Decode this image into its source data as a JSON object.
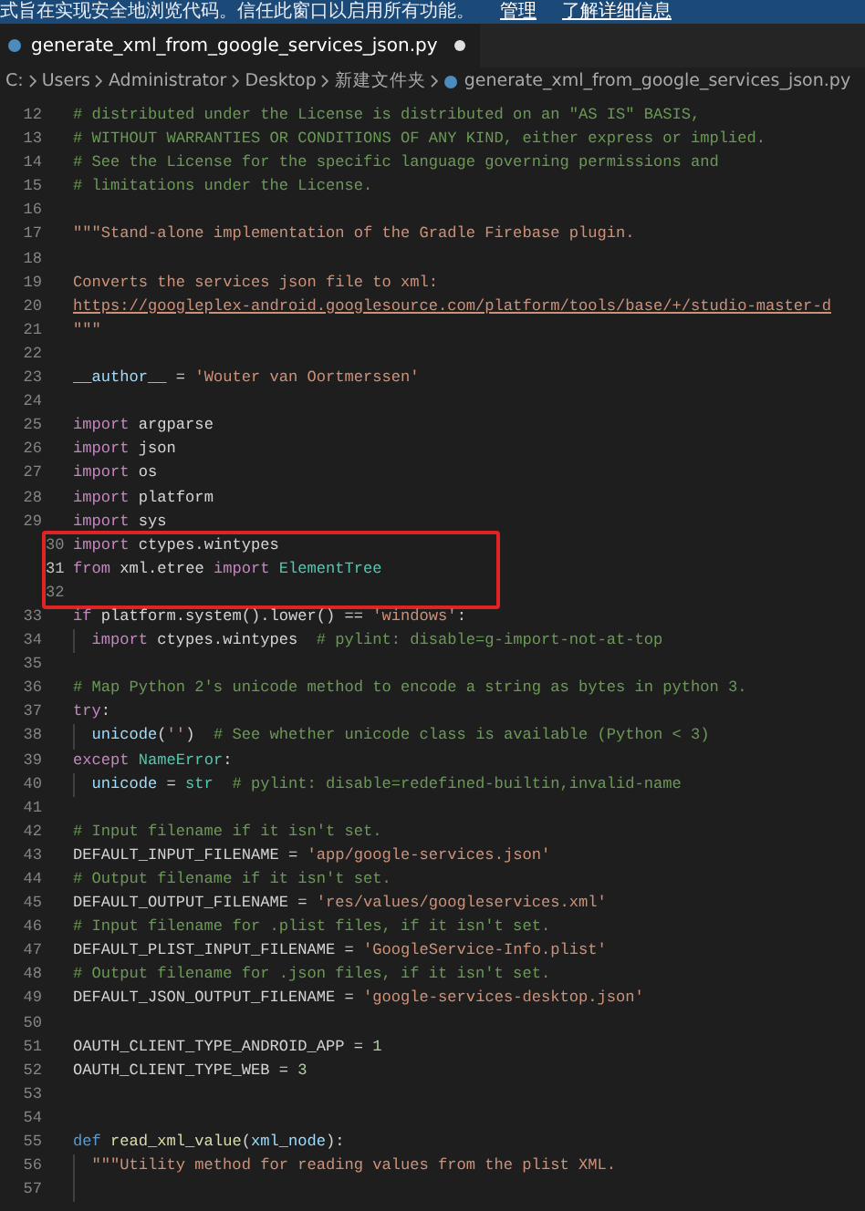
{
  "banner": {
    "text": "式旨在实现安全地浏览代码。信任此窗口以启用所有功能。",
    "links": [
      "管理",
      "了解详细信息"
    ]
  },
  "tab": {
    "title": "generate_xml_from_google_services_json.py",
    "modified": true
  },
  "breadcrumb": [
    "C:",
    "Users",
    "Administrator",
    "Desktop",
    "新建文件夹",
    "generate_xml_from_google_services_json.py"
  ],
  "lines": [
    {
      "number": "12",
      "current": false,
      "boxed": false,
      "guide": false,
      "tokens": [
        {
          "kind": "comment",
          "text": "# distributed under the License is distributed on an \"AS IS\" BASIS,"
        }
      ]
    },
    {
      "number": "13",
      "current": false,
      "boxed": false,
      "guide": false,
      "tokens": [
        {
          "kind": "comment",
          "text": "# WITHOUT WARRANTIES OR CONDITIONS OF ANY KIND, either express or implied."
        }
      ]
    },
    {
      "number": "14",
      "current": false,
      "boxed": false,
      "guide": false,
      "tokens": [
        {
          "kind": "comment",
          "text": "# See the License for the specific language governing permissions and"
        }
      ]
    },
    {
      "number": "15",
      "current": false,
      "boxed": false,
      "guide": false,
      "tokens": [
        {
          "kind": "comment",
          "text": "# limitations under the License."
        }
      ]
    },
    {
      "number": "16",
      "current": false,
      "boxed": false,
      "guide": false
    },
    {
      "number": "17",
      "current": false,
      "boxed": false,
      "guide": false,
      "tokens": [
        {
          "kind": "string",
          "text": "\"\"\"Stand-alone implementation of the Gradle Firebase plugin."
        }
      ]
    },
    {
      "number": "18",
      "current": false,
      "boxed": false,
      "guide": false
    },
    {
      "number": "19",
      "current": false,
      "boxed": false,
      "guide": false,
      "tokens": [
        {
          "kind": "string",
          "text": "Converts the services json file to xml:"
        }
      ]
    },
    {
      "number": "20",
      "current": false,
      "boxed": false,
      "guide": false,
      "tokens": [
        {
          "kind": "link",
          "text": "https://googleplex-android.googlesource.com/platform/tools/base/+/studio-master-d"
        }
      ]
    },
    {
      "number": "21",
      "current": false,
      "boxed": false,
      "guide": false,
      "tokens": [
        {
          "kind": "string",
          "text": "\"\"\""
        }
      ]
    },
    {
      "number": "22",
      "current": false,
      "boxed": false,
      "guide": false
    },
    {
      "number": "23",
      "current": false,
      "boxed": false,
      "guide": false,
      "tokens": [
        {
          "kind": "variable",
          "text": "__author__"
        },
        {
          "kind": "plain",
          "text": " = "
        },
        {
          "kind": "string",
          "text": "'Wouter van Oortmerssen'"
        }
      ]
    },
    {
      "number": "24",
      "current": false,
      "boxed": false,
      "guide": false
    },
    {
      "number": "25",
      "current": false,
      "boxed": false,
      "guide": false,
      "tokens": [
        {
          "kind": "keyword",
          "text": "import"
        },
        {
          "kind": "plain",
          "text": " argparse"
        }
      ]
    },
    {
      "number": "26",
      "current": false,
      "boxed": false,
      "guide": false,
      "tokens": [
        {
          "kind": "keyword",
          "text": "import"
        },
        {
          "kind": "plain",
          "text": " json"
        }
      ]
    },
    {
      "number": "27",
      "current": false,
      "boxed": false,
      "guide": false,
      "tokens": [
        {
          "kind": "keyword",
          "text": "import"
        },
        {
          "kind": "plain",
          "text": " os"
        }
      ]
    },
    {
      "number": "28",
      "current": false,
      "boxed": false,
      "guide": false,
      "tokens": [
        {
          "kind": "keyword",
          "text": "import"
        },
        {
          "kind": "plain",
          "text": " platform"
        }
      ]
    },
    {
      "number": "29",
      "current": false,
      "boxed": false,
      "guide": false,
      "tokens": [
        {
          "kind": "keyword",
          "text": "import"
        },
        {
          "kind": "plain",
          "text": " sys"
        }
      ]
    },
    {
      "number": "30",
      "current": false,
      "boxed": true,
      "guide": false,
      "tokens": [
        {
          "kind": "keyword",
          "text": "import"
        },
        {
          "kind": "plain",
          "text": " ctypes.wintypes"
        }
      ]
    },
    {
      "number": "31",
      "current": true,
      "boxed": true,
      "guide": false,
      "tokens": [
        {
          "kind": "keyword",
          "text": "from"
        },
        {
          "kind": "plain",
          "text": " xml.etree "
        },
        {
          "kind": "keyword",
          "text": "import"
        },
        {
          "kind": "class",
          "text": " ElementTree"
        }
      ]
    },
    {
      "number": "32",
      "current": false,
      "boxed": true,
      "guide": false
    },
    {
      "number": "33",
      "current": false,
      "boxed": false,
      "guide": false,
      "tokens": [
        {
          "kind": "keyword",
          "text": "if"
        },
        {
          "kind": "plain",
          "text": " platform.system().lower() == "
        },
        {
          "kind": "string",
          "text": "'windows'"
        },
        {
          "kind": "plain",
          "text": ":"
        }
      ]
    },
    {
      "number": "34",
      "current": false,
      "boxed": false,
      "guide": true,
      "tokens": [
        {
          "kind": "keyword",
          "text": "import"
        },
        {
          "kind": "plain",
          "text": " ctypes.wintypes  "
        },
        {
          "kind": "comment",
          "text": "# pylint: disable=g-import-not-at-top"
        }
      ]
    },
    {
      "number": "35",
      "current": false,
      "boxed": false,
      "guide": false
    },
    {
      "number": "36",
      "current": false,
      "boxed": false,
      "guide": false,
      "tokens": [
        {
          "kind": "comment",
          "text": "# Map Python 2's unicode method to encode a string as bytes in python 3."
        }
      ]
    },
    {
      "number": "37",
      "current": false,
      "boxed": false,
      "guide": false,
      "tokens": [
        {
          "kind": "keyword",
          "text": "try"
        },
        {
          "kind": "plain",
          "text": ":"
        }
      ]
    },
    {
      "number": "38",
      "current": false,
      "boxed": false,
      "guide": true,
      "tokens": [
        {
          "kind": "variable",
          "text": "unicode"
        },
        {
          "kind": "plain",
          "text": "("
        },
        {
          "kind": "string",
          "text": "''"
        },
        {
          "kind": "plain",
          "text": ")  "
        },
        {
          "kind": "comment",
          "text": "# See whether unicode class is available (Python < 3)"
        }
      ]
    },
    {
      "number": "39",
      "current": false,
      "boxed": false,
      "guide": false,
      "tokens": [
        {
          "kind": "keyword",
          "text": "except"
        },
        {
          "kind": "class",
          "text": " NameError"
        },
        {
          "kind": "plain",
          "text": ":"
        }
      ]
    },
    {
      "number": "40",
      "current": false,
      "boxed": false,
      "guide": true,
      "tokens": [
        {
          "kind": "variable",
          "text": "unicode"
        },
        {
          "kind": "plain",
          "text": " = "
        },
        {
          "kind": "class",
          "text": "str"
        },
        {
          "kind": "comment",
          "text": "  # pylint: disable=redefined-builtin,invalid-name"
        }
      ]
    },
    {
      "number": "41",
      "current": false,
      "boxed": false,
      "guide": false
    },
    {
      "number": "42",
      "current": false,
      "boxed": false,
      "guide": false,
      "tokens": [
        {
          "kind": "comment",
          "text": "# Input filename if it isn't set."
        }
      ]
    },
    {
      "number": "43",
      "current": false,
      "boxed": false,
      "guide": false,
      "tokens": [
        {
          "kind": "constant",
          "text": "DEFAULT_INPUT_FILENAME"
        },
        {
          "kind": "plain",
          "text": " = "
        },
        {
          "kind": "string",
          "text": "'app/google-services.json'"
        }
      ]
    },
    {
      "number": "44",
      "current": false,
      "boxed": false,
      "guide": false,
      "tokens": [
        {
          "kind": "comment",
          "text": "# Output filename if it isn't set."
        }
      ]
    },
    {
      "number": "45",
      "current": false,
      "boxed": false,
      "guide": false,
      "tokens": [
        {
          "kind": "constant",
          "text": "DEFAULT_OUTPUT_FILENAME"
        },
        {
          "kind": "plain",
          "text": " = "
        },
        {
          "kind": "string",
          "text": "'res/values/googleservices.xml'"
        }
      ]
    },
    {
      "number": "46",
      "current": false,
      "boxed": false,
      "guide": false,
      "tokens": [
        {
          "kind": "comment",
          "text": "# Input filename for .plist files, if it isn't set."
        }
      ]
    },
    {
      "number": "47",
      "current": false,
      "boxed": false,
      "guide": false,
      "tokens": [
        {
          "kind": "constant",
          "text": "DEFAULT_PLIST_INPUT_FILENAME"
        },
        {
          "kind": "plain",
          "text": " = "
        },
        {
          "kind": "string",
          "text": "'GoogleService-Info.plist'"
        }
      ]
    },
    {
      "number": "48",
      "current": false,
      "boxed": false,
      "guide": false,
      "tokens": [
        {
          "kind": "comment",
          "text": "# Output filename for .json files, if it isn't set."
        }
      ]
    },
    {
      "number": "49",
      "current": false,
      "boxed": false,
      "guide": false,
      "tokens": [
        {
          "kind": "constant",
          "text": "DEFAULT_JSON_OUTPUT_FILENAME"
        },
        {
          "kind": "plain",
          "text": " = "
        },
        {
          "kind": "string",
          "text": "'google-services-desktop.json'"
        }
      ]
    },
    {
      "number": "50",
      "current": false,
      "boxed": false,
      "guide": false
    },
    {
      "number": "51",
      "current": false,
      "boxed": false,
      "guide": false,
      "tokens": [
        {
          "kind": "constant",
          "text": "OAUTH_CLIENT_TYPE_ANDROID_APP"
        },
        {
          "kind": "plain",
          "text": " = "
        },
        {
          "kind": "number",
          "text": "1"
        }
      ]
    },
    {
      "number": "52",
      "current": false,
      "boxed": false,
      "guide": false,
      "tokens": [
        {
          "kind": "constant",
          "text": "OAUTH_CLIENT_TYPE_WEB"
        },
        {
          "kind": "plain",
          "text": " = "
        },
        {
          "kind": "number",
          "text": "3"
        }
      ]
    },
    {
      "number": "53",
      "current": false,
      "boxed": false,
      "guide": false
    },
    {
      "number": "54",
      "current": false,
      "boxed": false,
      "guide": false
    },
    {
      "number": "55",
      "current": false,
      "boxed": false,
      "guide": false,
      "tokens": [
        {
          "kind": "storage",
          "text": "def"
        },
        {
          "kind": "function",
          "text": " read_xml_value"
        },
        {
          "kind": "plain",
          "text": "("
        },
        {
          "kind": "variable",
          "text": "xml_node"
        },
        {
          "kind": "plain",
          "text": "):"
        }
      ]
    },
    {
      "number": "56",
      "current": false,
      "boxed": false,
      "guide": true,
      "tokens": [
        {
          "kind": "string",
          "text": "\"\"\"Utility method for reading values from the plist XML."
        }
      ]
    },
    {
      "number": "57",
      "current": false,
      "boxed": false,
      "guide": true
    }
  ]
}
